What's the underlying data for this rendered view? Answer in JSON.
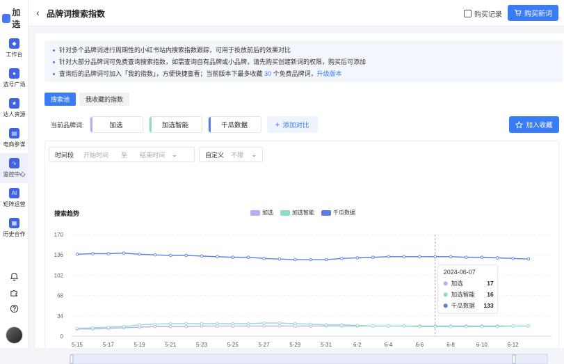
{
  "app": {
    "name": "加选"
  },
  "sidebar": {
    "items": [
      {
        "label": "工作台",
        "icon": "workbench-icon"
      },
      {
        "label": "选号广场",
        "icon": "user-icon"
      },
      {
        "label": "达人资源",
        "icon": "star-folder-icon"
      },
      {
        "label": "电商参谋",
        "icon": "bag-icon"
      },
      {
        "label": "监控中心",
        "icon": "monitor-icon"
      },
      {
        "label": "矩阵运营",
        "icon": "ai-icon"
      },
      {
        "label": "历史合作",
        "icon": "history-icon"
      }
    ],
    "active_index": 4
  },
  "header": {
    "title": "品牌词搜索指数",
    "purchase_record": "购买记录",
    "buy_button": "购买新词"
  },
  "notice": {
    "line1": "针对多个品牌词进行周期性的小红书站内搜索指数跟踪，可用于投放前后的效果对比",
    "line2": "针对大部分品牌词可免费查询搜索指数，如需查询自有品牌或小品牌，请先购买创建新词的权限，购买后可添加",
    "line3_a": "查询后的品牌词可加入「我的指数」，方便快捷查看；当前版本下最多收藏",
    "line3_num": "30",
    "line3_b": "个免费品牌词，",
    "line3_link": "升级版本"
  },
  "tabs": [
    "搜索池",
    "我收藏的指数"
  ],
  "brands": {
    "label": "当前品牌词:",
    "items": [
      {
        "name": "加选",
        "color": "#b9aef2"
      },
      {
        "name": "加选智能",
        "color": "#8fdcc7"
      },
      {
        "name": "千瓜数据",
        "color": "#5b7fe0"
      }
    ],
    "add_compare": "添加对比",
    "favorite": "加入收藏"
  },
  "filter": {
    "period_label": "时间段",
    "start_placeholder": "开始时间",
    "to": "至",
    "end_placeholder": "结束时间",
    "custom_label": "自定义",
    "custom_value": "不限"
  },
  "chart_data": {
    "type": "line",
    "title": "搜索趋势",
    "x_ticks": [
      "5-15",
      "5-17",
      "5-19",
      "5-21",
      "5-23",
      "5-25",
      "5-27",
      "5-29",
      "5-31",
      "6-2",
      "6-4",
      "6-6",
      "6-8",
      "6-10",
      "6-12"
    ],
    "x_start": "5-15",
    "x_end": "6-13",
    "yticks": [
      0,
      34,
      68,
      102,
      136,
      170
    ],
    "ylim": [
      0,
      170
    ],
    "series": [
      {
        "name": "加选",
        "color": "#b9aef2",
        "values": [
          12,
          12,
          13,
          14,
          15,
          16,
          16,
          16,
          17,
          17,
          17,
          17,
          17,
          17,
          17,
          17,
          17,
          17,
          17,
          17,
          17,
          17,
          17,
          17,
          17,
          17,
          17,
          17,
          17,
          17
        ]
      },
      {
        "name": "加选智能",
        "color": "#8fdcc7",
        "values": [
          13,
          14,
          15,
          16,
          19,
          20,
          21,
          21,
          21,
          21,
          21,
          21,
          22,
          22,
          21,
          20,
          19,
          19,
          18,
          17,
          17,
          17,
          16,
          16,
          16,
          16,
          16,
          16,
          17,
          17
        ]
      },
      {
        "name": "千瓜数据",
        "color": "#5b7fe0",
        "values": [
          137,
          138,
          138,
          139,
          137,
          136,
          135,
          135,
          134,
          133,
          132,
          132,
          130,
          129,
          128,
          128,
          128,
          130,
          131,
          132,
          133,
          133,
          133,
          133,
          133,
          132,
          132,
          131,
          130,
          129
        ]
      }
    ],
    "tooltip": {
      "date": "2024-06-07",
      "index": 23,
      "rows": [
        {
          "name": "加选",
          "value": 17
        },
        {
          "name": "加选智能",
          "value": 16
        },
        {
          "name": "千瓜数据",
          "value": 133
        }
      ]
    }
  }
}
